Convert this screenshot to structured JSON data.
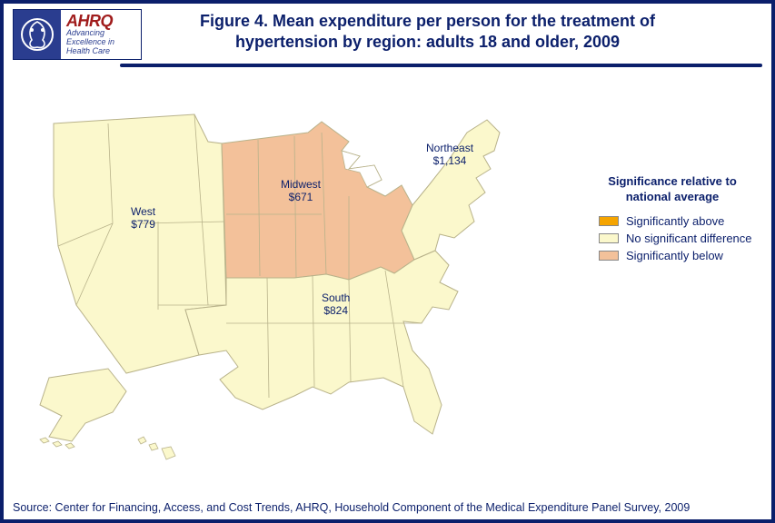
{
  "logo": {
    "brand": "AHRQ",
    "tagline": "Advancing Excellence in Health Care"
  },
  "title": "Figure 4. Mean expenditure per person for the treatment of hypertension by region: adults 18 and older, 2009",
  "legend": {
    "title": "Significance relative to national average",
    "items": [
      {
        "label": "Significantly above",
        "color": "#f5a400"
      },
      {
        "label": "No significant difference",
        "color": "#fbf8cc"
      },
      {
        "label": "Significantly below",
        "color": "#f3c19a"
      }
    ]
  },
  "regions": {
    "west": {
      "name": "West",
      "value": "$779",
      "category": "no_diff"
    },
    "midwest": {
      "name": "Midwest",
      "value": "$671",
      "category": "below"
    },
    "south": {
      "name": "South",
      "value": "$824",
      "category": "no_diff"
    },
    "northeast": {
      "name": "Northeast",
      "value": "$1,134",
      "category": "no_diff"
    }
  },
  "colors": {
    "above": "#f5a400",
    "no_diff": "#fbf8cc",
    "below": "#f3c19a",
    "stroke": "#b8b28a",
    "ink": "#0b1f6b"
  },
  "source": "Source: Center for Financing, Access, and Cost Trends, AHRQ, Household Component of the Medical Expenditure Panel Survey, 2009",
  "chart_data": {
    "type": "choropleth-map",
    "title": "Mean expenditure per person for the treatment of hypertension by region: adults 18 and older, 2009",
    "geography": "US Census regions",
    "variable": "Mean expenditure per person (USD)",
    "legend_variable": "Significance relative to national average",
    "categories_legend": [
      "Significantly above",
      "No significant difference",
      "Significantly below"
    ],
    "series": [
      {
        "region": "West",
        "value_usd": 779,
        "significance": "No significant difference"
      },
      {
        "region": "Midwest",
        "value_usd": 671,
        "significance": "Significantly below"
      },
      {
        "region": "South",
        "value_usd": 824,
        "significance": "No significant difference"
      },
      {
        "region": "Northeast",
        "value_usd": 1134,
        "significance": "No significant difference"
      }
    ]
  }
}
